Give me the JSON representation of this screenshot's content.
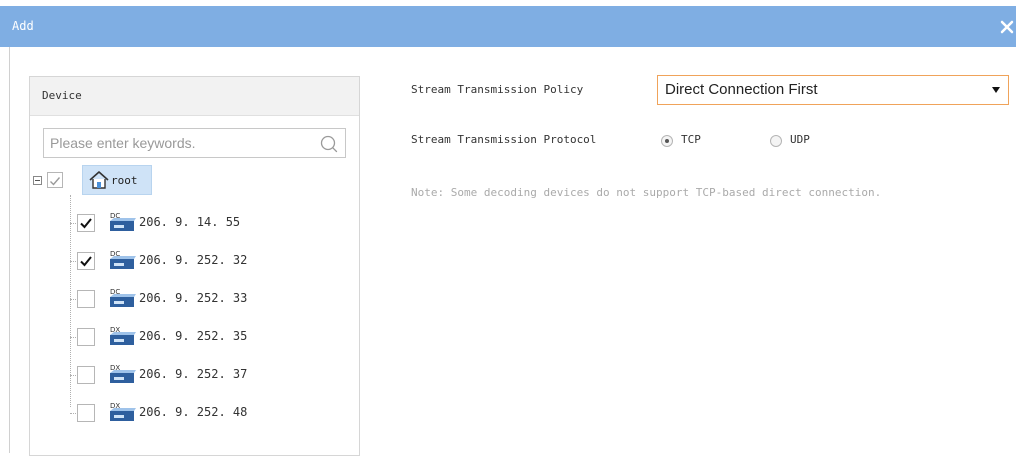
{
  "window": {
    "title": "Add",
    "close_icon": "close-icon"
  },
  "device_panel": {
    "header": "Device",
    "search": {
      "placeholder": "Please enter keywords.",
      "value": ""
    },
    "root": {
      "label": "root",
      "checked": true,
      "expanded": true
    },
    "devices": [
      {
        "ip": "206. 9. 14. 55",
        "type": "DC",
        "checked": true
      },
      {
        "ip": "206. 9. 252. 32",
        "type": "DC",
        "checked": true
      },
      {
        "ip": "206. 9. 252. 33",
        "type": "DC",
        "checked": false
      },
      {
        "ip": "206. 9. 252. 35",
        "type": "DX",
        "checked": false
      },
      {
        "ip": "206. 9. 252. 37",
        "type": "DX",
        "checked": false
      },
      {
        "ip": "206. 9. 252. 48",
        "type": "DX",
        "checked": false
      }
    ]
  },
  "form": {
    "policy_label": "Stream Transmission Policy",
    "policy_value": "Direct Connection First",
    "protocol_label": "Stream Transmission Protocol",
    "protocol_options": [
      {
        "label": "TCP",
        "selected": true
      },
      {
        "label": "UDP",
        "selected": false
      }
    ],
    "note": "Note: Some decoding devices do not support TCP-based direct connection."
  },
  "colors": {
    "titlebar": "#7faee3",
    "select_border": "#f0a35a",
    "root_highlight": "#cfe3f7"
  }
}
